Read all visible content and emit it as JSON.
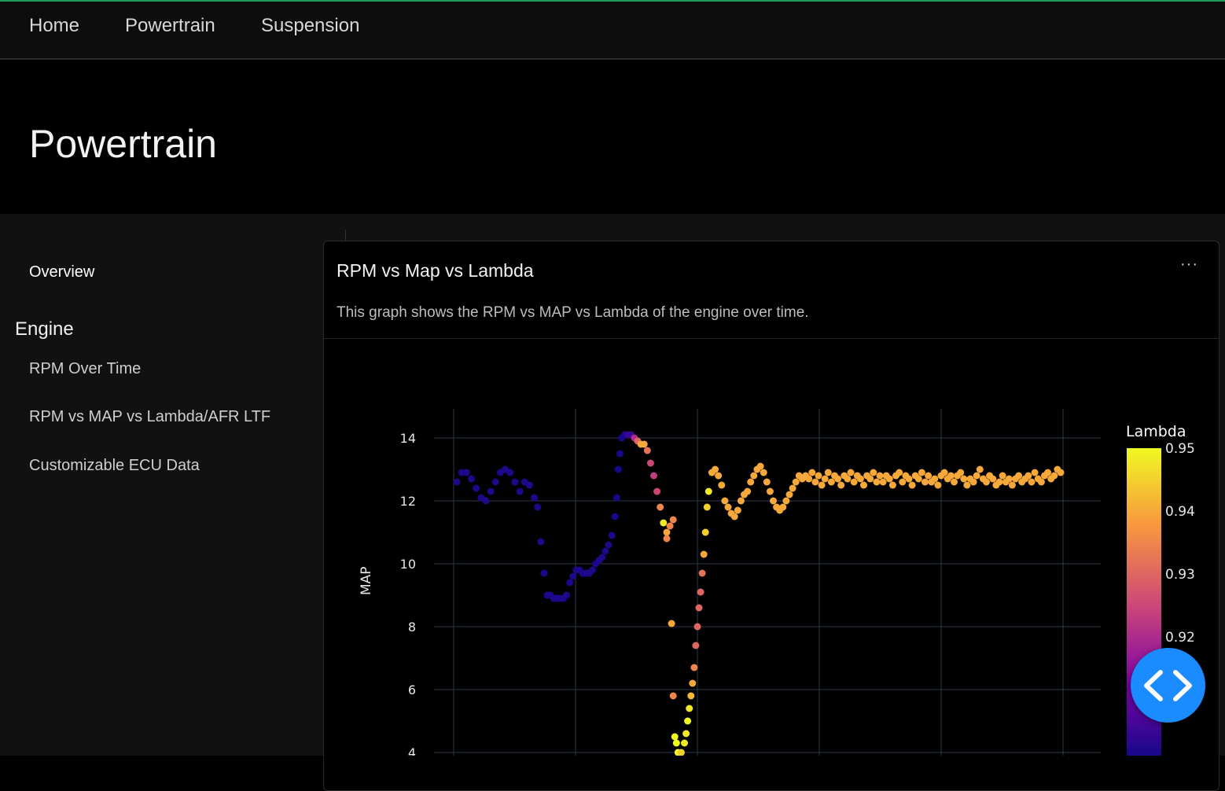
{
  "nav": {
    "items": [
      {
        "label": "Home"
      },
      {
        "label": "Powertrain"
      },
      {
        "label": "Suspension"
      }
    ]
  },
  "page": {
    "title": "Powertrain"
  },
  "sidebar": {
    "overview": "Overview",
    "section_heading": "Engine",
    "items": [
      {
        "label": "RPM Over Time"
      },
      {
        "label": "RPM vs MAP vs Lambda/AFR LTF"
      },
      {
        "label": "Customizable ECU Data"
      }
    ]
  },
  "card": {
    "title": "RPM vs Map vs Lambda",
    "menu_icon": "ellipsis-icon",
    "menu_glyph": "···",
    "description": "This graph shows the RPM vs MAP vs Lambda of the engine over time."
  },
  "fab": {
    "icon": "code-icon"
  },
  "chart_data": {
    "type": "scatter",
    "title": "",
    "xlabel": "",
    "ylabel": "MAP",
    "ylim": [
      3.8,
      14.9
    ],
    "yticks": [
      4,
      6,
      8,
      10,
      12,
      14
    ],
    "colorbar": {
      "title": "Lambda",
      "range": [
        0.9,
        0.95
      ],
      "ticks": [
        0.95,
        0.94,
        0.93,
        0.92
      ],
      "colorscale": "plasma"
    },
    "x_vertical_gridlines": 6,
    "grid": true,
    "points": [
      [
        0.2,
        12.6,
        0.902
      ],
      [
        0.5,
        12.9,
        0.902
      ],
      [
        0.8,
        12.9,
        0.902
      ],
      [
        1.1,
        12.7,
        0.902
      ],
      [
        1.4,
        12.4,
        0.902
      ],
      [
        1.7,
        12.1,
        0.902
      ],
      [
        2.0,
        12.0,
        0.902
      ],
      [
        2.3,
        12.3,
        0.902
      ],
      [
        2.6,
        12.6,
        0.902
      ],
      [
        2.9,
        12.9,
        0.902
      ],
      [
        3.2,
        13.0,
        0.902
      ],
      [
        3.5,
        12.9,
        0.902
      ],
      [
        3.8,
        12.6,
        0.902
      ],
      [
        4.1,
        12.3,
        0.902
      ],
      [
        4.4,
        12.6,
        0.902
      ],
      [
        4.7,
        12.5,
        0.902
      ],
      [
        5.0,
        12.1,
        0.902
      ],
      [
        5.2,
        11.8,
        0.902
      ],
      [
        5.4,
        10.7,
        0.902
      ],
      [
        5.6,
        9.7,
        0.902
      ],
      [
        5.8,
        9.0,
        0.902
      ],
      [
        6.0,
        9.0,
        0.902
      ],
      [
        6.2,
        8.9,
        0.902
      ],
      [
        6.4,
        8.9,
        0.902
      ],
      [
        6.6,
        8.9,
        0.902
      ],
      [
        6.8,
        8.9,
        0.902
      ],
      [
        7.0,
        9.0,
        0.902
      ],
      [
        7.2,
        9.4,
        0.902
      ],
      [
        7.4,
        9.6,
        0.902
      ],
      [
        7.6,
        9.8,
        0.902
      ],
      [
        7.8,
        9.8,
        0.902
      ],
      [
        8.0,
        9.7,
        0.902
      ],
      [
        8.2,
        9.7,
        0.902
      ],
      [
        8.4,
        9.7,
        0.902
      ],
      [
        8.6,
        9.8,
        0.902
      ],
      [
        8.8,
        10.0,
        0.902
      ],
      [
        9.0,
        10.1,
        0.902
      ],
      [
        9.2,
        10.2,
        0.902
      ],
      [
        9.4,
        10.4,
        0.902
      ],
      [
        9.6,
        10.6,
        0.902
      ],
      [
        9.8,
        10.9,
        0.902
      ],
      [
        10.0,
        11.5,
        0.901
      ],
      [
        10.1,
        12.1,
        0.901
      ],
      [
        10.2,
        13.0,
        0.901
      ],
      [
        10.3,
        13.5,
        0.901
      ],
      [
        10.4,
        14.0,
        0.901
      ],
      [
        10.6,
        14.1,
        0.902
      ],
      [
        10.8,
        14.1,
        0.905
      ],
      [
        11.0,
        14.1,
        0.905
      ],
      [
        11.2,
        14.0,
        0.92
      ],
      [
        11.4,
        13.9,
        0.93
      ],
      [
        11.6,
        13.8,
        0.94
      ],
      [
        11.8,
        13.8,
        0.94
      ],
      [
        12.0,
        13.6,
        0.932
      ],
      [
        12.2,
        13.2,
        0.925
      ],
      [
        12.4,
        12.8,
        0.923
      ],
      [
        12.6,
        12.3,
        0.925
      ],
      [
        12.8,
        11.8,
        0.935
      ],
      [
        13.0,
        11.3,
        0.948
      ],
      [
        13.2,
        11.0,
        0.94
      ],
      [
        13.4,
        11.2,
        0.935
      ],
      [
        13.6,
        11.4,
        0.935
      ],
      [
        13.2,
        10.8,
        0.935
      ],
      [
        13.5,
        8.1,
        0.94
      ],
      [
        13.6,
        5.8,
        0.935
      ],
      [
        13.7,
        4.5,
        0.95
      ],
      [
        13.8,
        4.3,
        0.95
      ],
      [
        13.9,
        4.0,
        0.95
      ],
      [
        14.0,
        3.9,
        0.948
      ],
      [
        14.1,
        4.0,
        0.945
      ],
      [
        14.3,
        4.3,
        0.948
      ],
      [
        14.4,
        4.6,
        0.948
      ],
      [
        14.5,
        5.0,
        0.95
      ],
      [
        14.6,
        5.4,
        0.948
      ],
      [
        14.7,
        5.8,
        0.942
      ],
      [
        14.8,
        6.2,
        0.94
      ],
      [
        14.9,
        6.7,
        0.935
      ],
      [
        15.0,
        7.4,
        0.93
      ],
      [
        15.1,
        8.0,
        0.93
      ],
      [
        15.2,
        8.6,
        0.93
      ],
      [
        15.3,
        9.1,
        0.93
      ],
      [
        15.4,
        9.7,
        0.932
      ],
      [
        15.5,
        10.3,
        0.94
      ],
      [
        15.6,
        11.0,
        0.945
      ],
      [
        15.7,
        11.8,
        0.945
      ],
      [
        15.8,
        12.3,
        0.948
      ],
      [
        16.0,
        12.9,
        0.94
      ],
      [
        16.2,
        13.0,
        0.94
      ],
      [
        16.4,
        12.8,
        0.94
      ],
      [
        16.6,
        12.5,
        0.94
      ],
      [
        16.8,
        12.0,
        0.94
      ],
      [
        17.0,
        11.8,
        0.94
      ],
      [
        17.2,
        11.6,
        0.94
      ],
      [
        17.4,
        11.5,
        0.94
      ],
      [
        17.6,
        11.7,
        0.94
      ],
      [
        17.8,
        12.0,
        0.94
      ],
      [
        18.0,
        12.2,
        0.94
      ],
      [
        18.2,
        12.3,
        0.94
      ],
      [
        18.4,
        12.6,
        0.94
      ],
      [
        18.6,
        12.8,
        0.94
      ],
      [
        18.8,
        13.0,
        0.94
      ],
      [
        19.0,
        13.1,
        0.94
      ],
      [
        19.2,
        12.9,
        0.94
      ],
      [
        19.4,
        12.6,
        0.94
      ],
      [
        19.6,
        12.3,
        0.94
      ],
      [
        19.8,
        12.0,
        0.94
      ],
      [
        20.0,
        11.8,
        0.94
      ],
      [
        20.2,
        11.7,
        0.94
      ],
      [
        20.4,
        11.8,
        0.94
      ],
      [
        20.6,
        12.0,
        0.94
      ],
      [
        20.8,
        12.2,
        0.94
      ],
      [
        21.0,
        12.4,
        0.94
      ],
      [
        21.2,
        12.6,
        0.94
      ],
      [
        21.4,
        12.8,
        0.94
      ],
      [
        21.6,
        12.7,
        0.94
      ],
      [
        21.8,
        12.8,
        0.94
      ],
      [
        22.0,
        12.7,
        0.94
      ],
      [
        22.2,
        12.9,
        0.94
      ],
      [
        22.4,
        12.6,
        0.94
      ],
      [
        22.6,
        12.8,
        0.94
      ],
      [
        22.8,
        12.5,
        0.94
      ],
      [
        23.0,
        12.7,
        0.94
      ],
      [
        23.2,
        12.9,
        0.94
      ],
      [
        23.4,
        12.6,
        0.94
      ],
      [
        23.6,
        12.8,
        0.94
      ],
      [
        23.8,
        12.7,
        0.94
      ],
      [
        24.0,
        12.5,
        0.94
      ],
      [
        24.2,
        12.8,
        0.94
      ],
      [
        24.4,
        12.7,
        0.94
      ],
      [
        24.6,
        12.9,
        0.94
      ],
      [
        24.8,
        12.6,
        0.94
      ],
      [
        25.0,
        12.8,
        0.94
      ],
      [
        25.2,
        12.7,
        0.94
      ],
      [
        25.4,
        12.5,
        0.94
      ],
      [
        25.6,
        12.8,
        0.94
      ],
      [
        25.8,
        12.7,
        0.94
      ],
      [
        26.0,
        12.9,
        0.94
      ],
      [
        26.2,
        12.6,
        0.94
      ],
      [
        26.4,
        12.8,
        0.94
      ],
      [
        26.6,
        12.6,
        0.94
      ],
      [
        26.8,
        12.8,
        0.94
      ],
      [
        27.0,
        12.7,
        0.94
      ],
      [
        27.2,
        12.5,
        0.94
      ],
      [
        27.4,
        12.8,
        0.94
      ],
      [
        27.6,
        12.9,
        0.94
      ],
      [
        27.8,
        12.6,
        0.94
      ],
      [
        28.0,
        12.8,
        0.94
      ],
      [
        28.2,
        12.7,
        0.94
      ],
      [
        28.4,
        12.5,
        0.94
      ],
      [
        28.6,
        12.8,
        0.94
      ],
      [
        28.8,
        12.7,
        0.94
      ],
      [
        29.0,
        12.9,
        0.94
      ],
      [
        29.2,
        12.6,
        0.94
      ],
      [
        29.4,
        12.8,
        0.94
      ],
      [
        29.6,
        12.6,
        0.94
      ],
      [
        29.8,
        12.7,
        0.94
      ],
      [
        30.0,
        12.5,
        0.94
      ],
      [
        30.2,
        12.8,
        0.94
      ],
      [
        30.4,
        12.9,
        0.94
      ],
      [
        30.6,
        12.7,
        0.94
      ],
      [
        30.8,
        12.8,
        0.94
      ],
      [
        31.0,
        12.6,
        0.94
      ],
      [
        31.2,
        12.8,
        0.94
      ],
      [
        31.4,
        12.9,
        0.94
      ],
      [
        31.6,
        12.7,
        0.94
      ],
      [
        31.8,
        12.5,
        0.94
      ],
      [
        32.0,
        12.7,
        0.94
      ],
      [
        32.2,
        12.6,
        0.94
      ],
      [
        32.4,
        12.8,
        0.94
      ],
      [
        32.6,
        13.0,
        0.94
      ],
      [
        32.8,
        12.7,
        0.94
      ],
      [
        33.0,
        12.6,
        0.94
      ],
      [
        33.2,
        12.8,
        0.94
      ],
      [
        33.4,
        12.7,
        0.94
      ],
      [
        33.6,
        12.5,
        0.94
      ],
      [
        33.8,
        12.6,
        0.94
      ],
      [
        34.0,
        12.8,
        0.94
      ],
      [
        34.2,
        12.6,
        0.94
      ],
      [
        34.4,
        12.7,
        0.94
      ],
      [
        34.6,
        12.5,
        0.94
      ],
      [
        34.8,
        12.7,
        0.94
      ],
      [
        35.0,
        12.8,
        0.94
      ],
      [
        35.2,
        12.6,
        0.94
      ],
      [
        35.4,
        12.7,
        0.94
      ],
      [
        35.6,
        12.8,
        0.94
      ],
      [
        35.8,
        12.6,
        0.94
      ],
      [
        36.0,
        12.9,
        0.94
      ],
      [
        36.2,
        12.7,
        0.94
      ],
      [
        36.4,
        12.6,
        0.94
      ],
      [
        36.6,
        12.8,
        0.94
      ],
      [
        36.8,
        12.9,
        0.94
      ],
      [
        37.0,
        12.7,
        0.94
      ],
      [
        37.2,
        12.8,
        0.94
      ],
      [
        37.4,
        13.0,
        0.94
      ],
      [
        37.6,
        12.9,
        0.94
      ]
    ]
  }
}
